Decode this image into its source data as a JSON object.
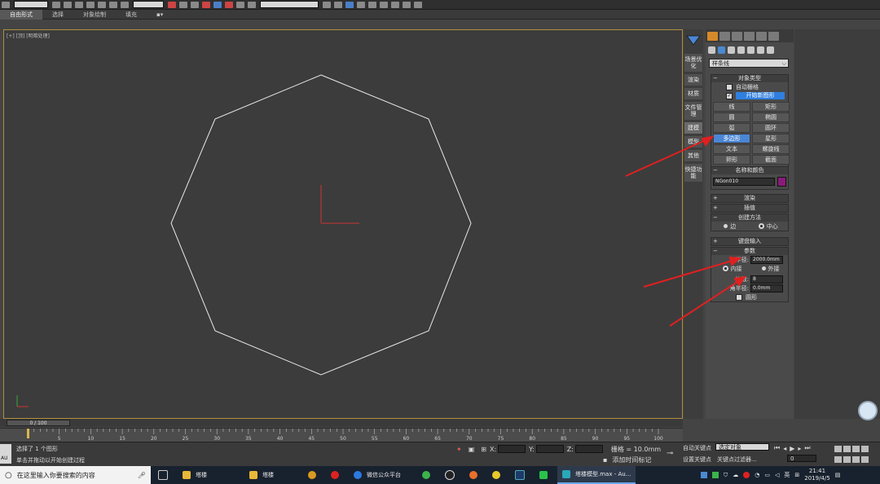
{
  "ribbon": {
    "tabs": [
      "自由形式",
      "选择",
      "对象绘制",
      "填充"
    ]
  },
  "viewport": {
    "label": "[+] [顶] [明暗处理]"
  },
  "side_tabs": [
    "场景优化",
    "渲染",
    "材质",
    "文件管理",
    "建模",
    "模型",
    "其他",
    "快捷功能"
  ],
  "command_panel": {
    "category": "样条线",
    "object_type": {
      "title": "对象类型",
      "auto_grid": "自动栅格",
      "start_new_shape": "开始新图形",
      "buttons": [
        "线",
        "矩形",
        "圆",
        "椭圆",
        "弧",
        "圆环",
        "多边形",
        "星形",
        "文本",
        "螺旋线",
        "卵形",
        "截面"
      ],
      "selected": "多边形"
    },
    "name_color": {
      "title": "名称和颜色",
      "name": "NGon010",
      "color": "#8b1a7a"
    },
    "rollouts": {
      "render": "渲染",
      "interp": "插值"
    },
    "creation": {
      "title": "创建方法",
      "edge": "边",
      "center": "中心"
    },
    "keyboard": "键盘输入",
    "params": {
      "title": "参数",
      "radius_label": "半径:",
      "radius": "2000.0mm",
      "inscribed": "内接",
      "circumscribed": "外接",
      "sides_label": "边数:",
      "sides": "8",
      "corner_label": "角半径:",
      "corner": "0.0mm",
      "circular": "圆形"
    }
  },
  "timeline": {
    "frame": "0 / 100",
    "ticks": [
      "5",
      "10",
      "15",
      "20",
      "25",
      "30",
      "35",
      "40",
      "45",
      "50",
      "55",
      "60",
      "65",
      "70",
      "75",
      "80",
      "85",
      "90",
      "95",
      "100"
    ]
  },
  "status": {
    "selected": "选择了 1 个图形",
    "prompt": "单击并拖动以开始创建过程",
    "maxscript": "AU",
    "x": "X:",
    "y": "Y:",
    "z": "Z:",
    "grid": "栅格 = 10.0mm",
    "add_time_tag": "添加时间标记",
    "auto_key": "自动关键点",
    "selected_option": "选定对象",
    "set_key": "设置关键点",
    "key_filters": "关键点过滤器...",
    "frame_value": "0"
  },
  "taskbar": {
    "search_placeholder": "在这里输入你要搜索的内容",
    "items": [
      "塔楼",
      "塔楼",
      "微信公众平台",
      "塔楼模型.max - Au..."
    ],
    "time": "21:41",
    "date": "2019/4/5",
    "lang": "英"
  },
  "colors": {
    "viewport_border": "#b08f3c",
    "selection_blue": "#4a86d4",
    "arrow_red": "#e02020"
  }
}
